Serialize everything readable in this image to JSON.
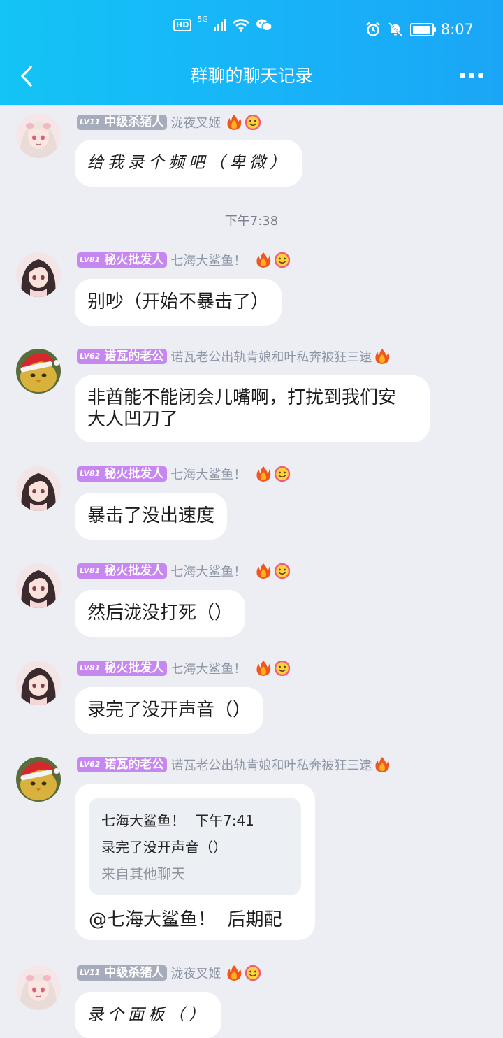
{
  "status_bar": {
    "hd": "HD",
    "network": "5G",
    "time": "8:07",
    "icons": [
      "hd-icon",
      "signal-icon",
      "wifi-icon",
      "wechat-icon",
      "alarm-icon",
      "mute-icon",
      "battery-icon"
    ]
  },
  "header": {
    "title": "群聊的聊天记录",
    "back_icon": "chevron-left-icon",
    "more_icon": "more-dots-icon"
  },
  "messages": [
    {
      "badge_level": "LV11",
      "badge_title": "中级杀猪人",
      "badge_color": "#a6acbb",
      "nickname": "泷夜叉姬",
      "avatar": "girl-white-hair-avatar",
      "text": "给我录个频吧（卑微）"
    },
    {
      "type": "timestamp",
      "text": "下午7:38"
    },
    {
      "badge_level": "LV81",
      "badge_title": "秘火批发人",
      "badge_color": "#c787f0",
      "nickname": "七海大鲨鱼！",
      "avatar": "girl-dark-hair-avatar",
      "text": "别吵（开始不暴击了）"
    },
    {
      "badge_level": "LV62",
      "badge_title": "诺瓦的老公",
      "badge_color": "#c787f0",
      "nickname": "诺瓦老公出轨肯娘和叶私奔被狂三逮",
      "avatar": "chick-santa-hat-avatar",
      "text_lines": [
        "非酋能不能闭会儿嘴啊，打扰到我们安",
        "大人凹刀了"
      ]
    },
    {
      "badge_level": "LV81",
      "badge_title": "秘火批发人",
      "badge_color": "#c787f0",
      "nickname": "七海大鲨鱼！",
      "avatar": "girl-dark-hair-avatar",
      "text": "暴击了没出速度"
    },
    {
      "badge_level": "LV81",
      "badge_title": "秘火批发人",
      "badge_color": "#c787f0",
      "nickname": "七海大鲨鱼！",
      "avatar": "girl-dark-hair-avatar",
      "text": "然后泷没打死（）"
    },
    {
      "badge_level": "LV81",
      "badge_title": "秘火批发人",
      "badge_color": "#c787f0",
      "nickname": "七海大鲨鱼！",
      "avatar": "girl-dark-hair-avatar",
      "text": "录完了没开声音（）"
    },
    {
      "badge_level": "LV62",
      "badge_title": "诺瓦的老公",
      "badge_color": "#c787f0",
      "nickname": "诺瓦老公出轨肯娘和叶私奔被狂三逮",
      "avatar": "chick-santa-hat-avatar",
      "quote": {
        "author": "七海大鲨鱼！",
        "time": "下午7:41",
        "text": "录完了没开声音（）",
        "source": "来自其他聊天"
      },
      "text": "@七海大鲨鱼！  后期配"
    },
    {
      "badge_level": "LV11",
      "badge_title": "中级杀猪人",
      "badge_color": "#a6acbb",
      "nickname": "泷夜叉姬",
      "avatar": "girl-white-hair-avatar",
      "text": "录个面板（）"
    }
  ],
  "colors": {
    "header": "#18b3f8",
    "background": "#eceef4",
    "badge_gray": "#a6acbb",
    "badge_purple": "#c787f0"
  }
}
